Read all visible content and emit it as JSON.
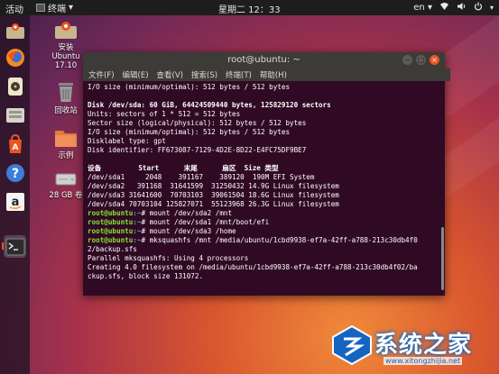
{
  "topbar": {
    "activities": "活动",
    "app_name": "终端",
    "clock": "星期二 12：33",
    "lang": "en",
    "lang_arrow": "▾",
    "app_arrow": "▾"
  },
  "desktop": {
    "install_label_1": "安装",
    "install_label_2": "Ubuntu",
    "install_label_3": "17.10",
    "trash_label": "回收站",
    "examples_label": "示例",
    "volume_label": "28 GB 卷"
  },
  "terminal": {
    "title": "root@ubuntu: ~",
    "menu": [
      "文件(F)",
      "编辑(E)",
      "查看(V)",
      "搜索(S)",
      "终端(T)",
      "帮助(H)"
    ],
    "lines": {
      "l1": "I/O size (minimum/optimal): 512 bytes / 512 bytes",
      "l2": "",
      "l3": "Disk /dev/sda: 60 GiB, 64424509440 bytes, 125829120 sectors",
      "l4": "Units: sectors of 1 * 512 = 512 bytes",
      "l5": "Sector size (logical/physical): 512 bytes / 512 bytes",
      "l6": "I/O size (minimum/optimal): 512 bytes / 512 bytes",
      "l7": "Disklabel type: gpt",
      "l8": "Disk identifier: FF673087-7129-4D2E-8D22-E4FC75DF9BE7",
      "l9": "",
      "l10": "设备         Start      末尾      扇区  Size 类型",
      "l11": "/dev/sda1     2048    391167    389120  190M EFI System",
      "l12": "/dev/sda2   391168  31641599  31250432 14.9G Linux filesystem",
      "l13": "/dev/sda3 31641600  70703103  39061504 18.6G Linux filesystem",
      "l14": "/dev/sda4 70703104 125827071  55123968 26.3G Linux filesystem",
      "p1_user": "root@ubuntu",
      "p1_path": ":~",
      "p1_cmd": "# mount /dev/sda2 /mnt",
      "p2_user": "root@ubuntu",
      "p2_path": ":~",
      "p2_cmd": "# mount /dev/sda1 /mnt/boot/efi",
      "p3_user": "root@ubuntu",
      "p3_path": ":~",
      "p3_cmd": "# mount /dev/sda3 /home",
      "p4_user": "root@ubuntu",
      "p4_path": ":~",
      "p4_cmd": "# mksquashfs /mnt /media/ubuntu/1cbd9938-ef7a-42ff-a788-213c30db4f0",
      "l19": "2/backup.sfs",
      "l20": "Parallel mksquashfs: Using 4 processors",
      "l21": "Creating 4.0 filesystem on /media/ubuntu/1cbd9938-ef7a-42ff-a788-213c30db4f02/ba",
      "l22": "ckup.sfs, block size 131072."
    }
  },
  "watermark": {
    "text": "系统之家",
    "url": "www.xitongzhijia.net"
  },
  "colors": {
    "terminal_bg": "#300a24",
    "prompt_green": "#8ae234",
    "path_blue": "#729fcf",
    "accent_orange": "#e95420"
  }
}
